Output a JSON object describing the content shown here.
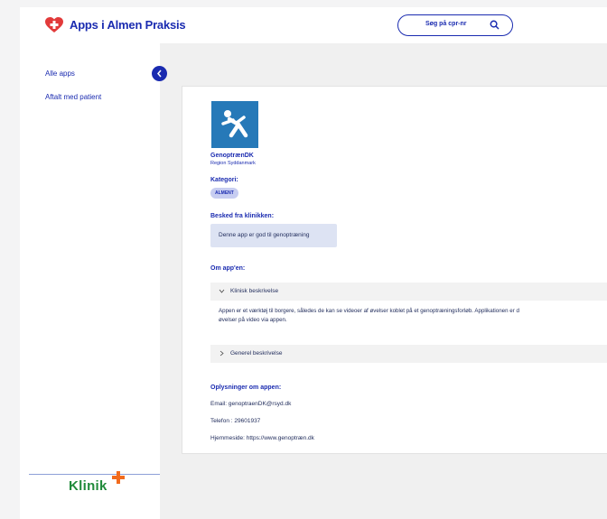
{
  "header": {
    "app_title": "Apps i Almen Praksis",
    "search_label": "Søg på cpr-nr"
  },
  "sidebar": {
    "items": [
      {
        "label": "Alle apps"
      },
      {
        "label": "Aftalt med patient"
      }
    ],
    "brand": "Klinik"
  },
  "app": {
    "name": "GenoptrænDK",
    "region": "Region Syddanmark",
    "category_heading": "Kategori:",
    "category_chip": "ALMENT",
    "message_heading": "Besked fra klinikken:",
    "message": "Denne app er god til genoptræning",
    "about_heading": "Om app'en:",
    "accordion": [
      {
        "label": "Klinisk beskrivelse",
        "expanded": true,
        "text_line1": "Appen er et værktøj til borgere, således de kan se videoer af øvelser koblet på et genoptræningsforløb. Applikationen er d",
        "text_line2": "øvelser på video via appen."
      },
      {
        "label": "Generel beskrivelse",
        "expanded": false
      }
    ],
    "info_heading": "Oplysninger om appen:",
    "email": "Email: genoptraenDK@rsyd.dk",
    "phone": "Telefon : 29601937",
    "homepage": "Hjemmeside: https://www.genoptræn.dk"
  },
  "colors": {
    "primary": "#1a2bb0",
    "logo_red": "#e23a3a",
    "brand_green": "#1f8a3a",
    "brand_orange": "#f26b1d",
    "app_icon_blue": "#2679b8"
  }
}
